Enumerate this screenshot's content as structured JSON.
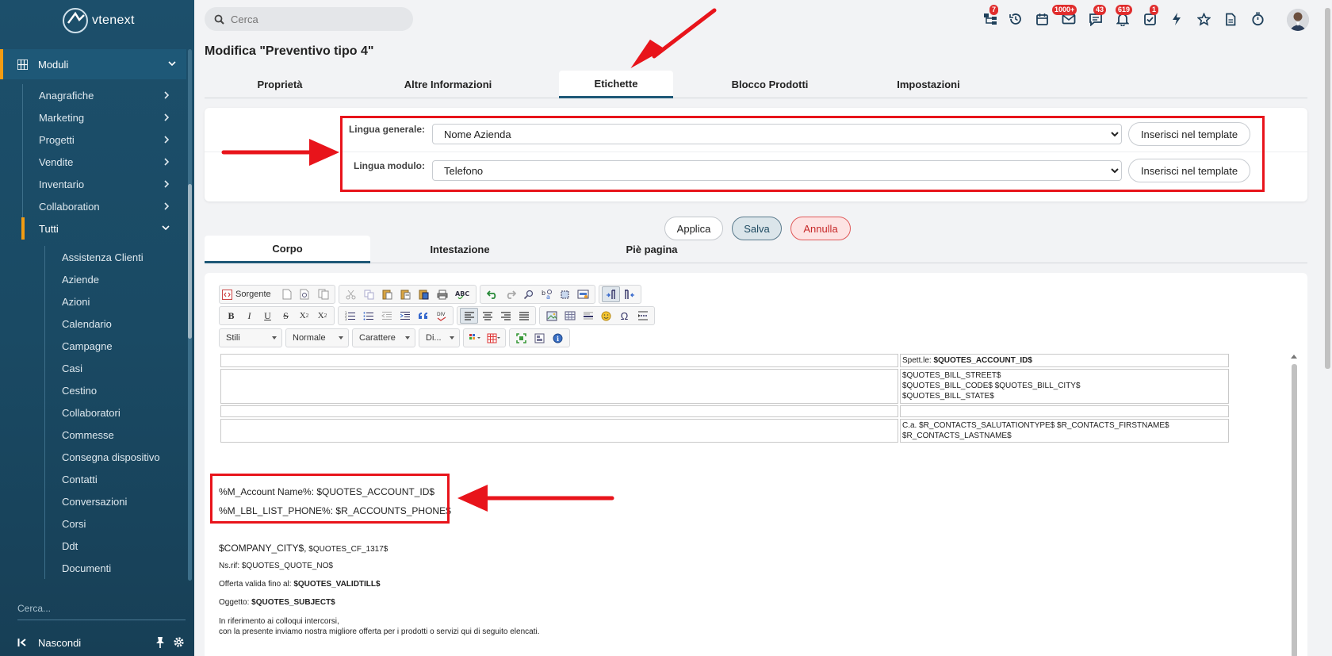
{
  "app": {
    "name": "vtenext"
  },
  "sidebar": {
    "modules_label": "Moduli",
    "groups": [
      {
        "label": "Anagrafiche"
      },
      {
        "label": "Marketing"
      },
      {
        "label": "Progetti"
      },
      {
        "label": "Vendite"
      },
      {
        "label": "Inventario"
      },
      {
        "label": "Collaboration"
      },
      {
        "label": "Tutti"
      }
    ],
    "sub_items": [
      "Assistenza Clienti",
      "Aziende",
      "Azioni",
      "Calendario",
      "Campagne",
      "Casi",
      "Cestino",
      "Collaboratori",
      "Commesse",
      "Consegna dispositivo",
      "Contatti",
      "Conversazioni",
      "Corsi",
      "Ddt",
      "Documenti"
    ],
    "search_placeholder": "Cerca...",
    "hide_label": "Nascondi"
  },
  "topbar": {
    "search_placeholder": "Cerca",
    "badges": {
      "processes": "7",
      "mail": "1000+",
      "chat": "43",
      "notifications": "619",
      "todo": "1"
    }
  },
  "page": {
    "title": "Modifica \"Preventivo tipo 4\"",
    "tabs": [
      "Proprietà",
      "Altre Informazioni",
      "Etichette",
      "Blocco Prodotti",
      "Impostazioni"
    ],
    "active_tab": "Etichette"
  },
  "labels": {
    "general_label": "Lingua generale:",
    "general_value": "Nome Azienda",
    "module_label": "Lingua modulo:",
    "module_value": "Telefono",
    "insert_button": "Inserisci nel template"
  },
  "actions": {
    "apply": "Applica",
    "save": "Salva",
    "cancel": "Annulla"
  },
  "editor_tabs": [
    "Corpo",
    "Intestazione",
    "Piè pagina"
  ],
  "toolbar": {
    "source": "Sorgente",
    "styles": "Stili",
    "format": "Normale",
    "font": "Carattere",
    "size": "Di..."
  },
  "document": {
    "header_table": {
      "r1": "Spett.le: ",
      "r1_bold": "$QUOTES_ACCOUNT_ID$",
      "r2_line1": "$QUOTES_BILL_STREET$",
      "r2_line2": "$QUOTES_BILL_CODE$ $QUOTES_BILL_CITY$",
      "r2_line3": "$QUOTES_BILL_STATE$",
      "r4": "C.a. $R_CONTACTS_SALUTATIONTYPE$ $R_CONTACTS_FIRSTNAME$ $R_CONTACTS_LASTNAME$"
    },
    "line_account": "%M_Account Name%: $QUOTES_ACCOUNT_ID$",
    "line_phone": "%M_LBL_LIST_PHONE%: $R_ACCOUNTS_PHONE$",
    "line_city": "$COMPANY_CITY$,",
    "line_city_cf": " $QUOTES_CF_1317$",
    "line_ref_label": "Ns.rif: ",
    "line_ref_value": "$QUOTES_QUOTE_NO$",
    "line_valid_label": "Offerta valida fino al: ",
    "line_valid_value": "$QUOTES_VALIDTILL$",
    "line_subject_label": "Oggetto: ",
    "line_subject_value": "$QUOTES_SUBJECT$",
    "line_intro1": "In riferimento ai colloqui intercorsi,",
    "line_intro2": "con la presente inviamo nostra migliore offerta per i prodotti o servizi qui di seguito elencati."
  },
  "colors": {
    "sidebar": "#1c4f6b",
    "accent": "#f39c12",
    "tab_underline": "#1e5877",
    "annotation": "#e8141b",
    "badge": "#e02d2d"
  }
}
